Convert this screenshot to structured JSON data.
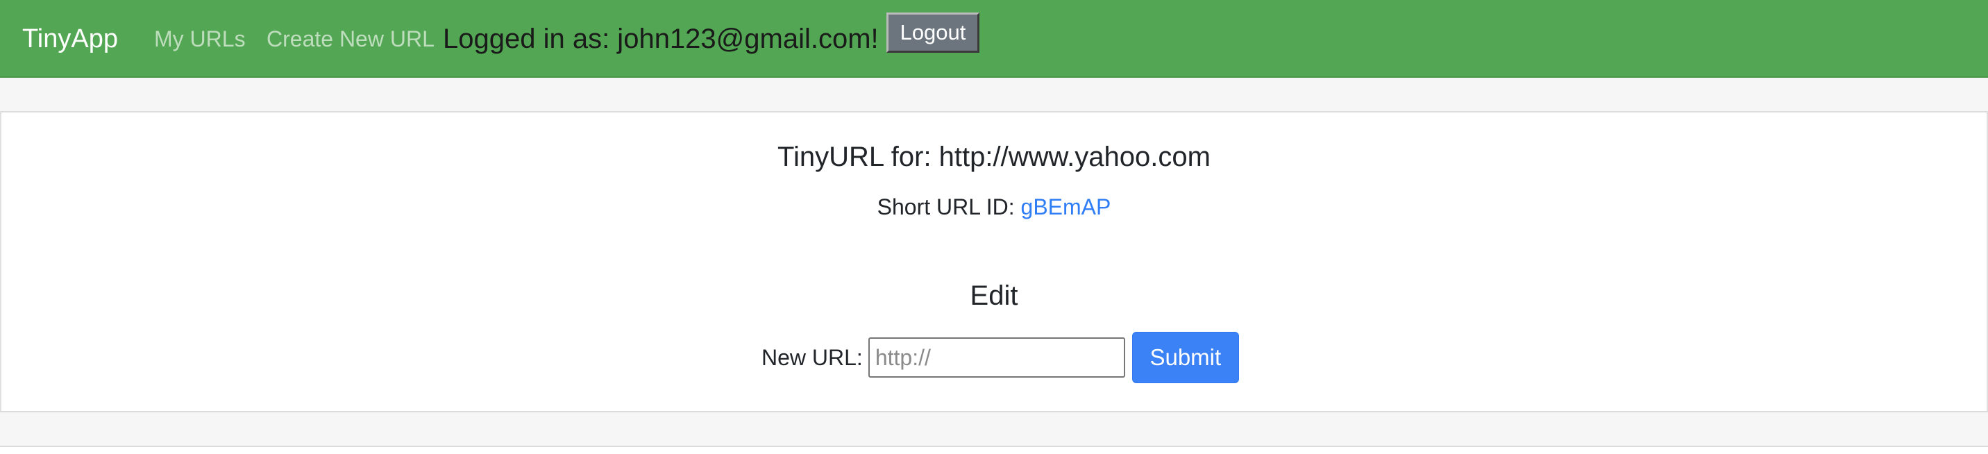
{
  "navbar": {
    "brand": "TinyApp",
    "links": [
      {
        "label": "My URLs"
      },
      {
        "label": "Create New URL"
      }
    ],
    "logged_in_text": "Logged in as: john123@gmail.com!",
    "logout_label": "Logout",
    "background_color": "#53a653"
  },
  "main": {
    "title": "TinyURL for: http://www.yahoo.com",
    "short_url_label": "Short URL ID: ",
    "short_url_id": "gBEmAP",
    "edit_heading": "Edit",
    "form": {
      "label": "New URL:",
      "input_value": "",
      "input_placeholder": "http://",
      "submit_label": "Submit"
    }
  },
  "colors": {
    "link": "#2f7ef6",
    "submit_button": "#3b82f6",
    "logout_button": "#6c757d"
  }
}
